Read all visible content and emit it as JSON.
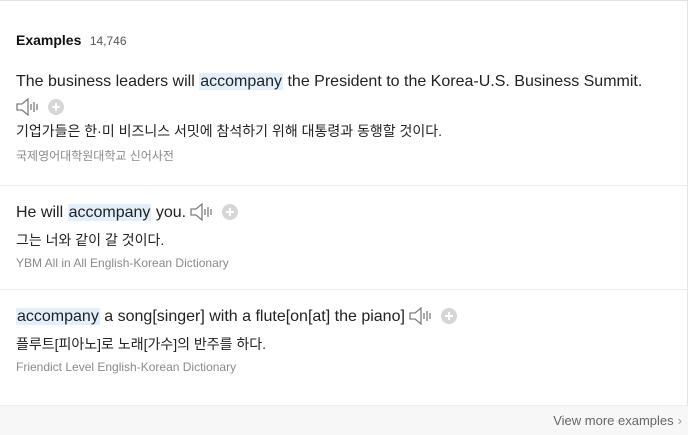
{
  "header": {
    "title": "Examples",
    "count": "14,746"
  },
  "examples": [
    {
      "en_before": "The business leaders will ",
      "en_highlight": "accompany",
      "en_after": " the President to the Korea-U.S. Business Summit.",
      "ko": "기업가들은 한·미 비즈니스 서밋에 참석하기 위해 대통령과 동행할 것이다.",
      "source": "국제영어대학원대학교 신어사전"
    },
    {
      "en_before": "He will ",
      "en_highlight": "accompany",
      "en_after": " you.",
      "ko": "그는 너와 같이 갈 것이다.",
      "source": "YBM All in All English-Korean Dictionary"
    },
    {
      "en_before": "",
      "en_highlight": "accompany",
      "en_after": " a song[singer] with a flute[on[at] the piano]",
      "ko": "플루트[피아노]로 노래[가수]의 반주를 하다.",
      "source": "Friendict Level English-Korean Dictionary"
    }
  ],
  "footer": {
    "more_label": "View more examples",
    "more_chevron": "›"
  },
  "icons": {
    "speaker": "speaker-icon",
    "add": "add-icon"
  }
}
